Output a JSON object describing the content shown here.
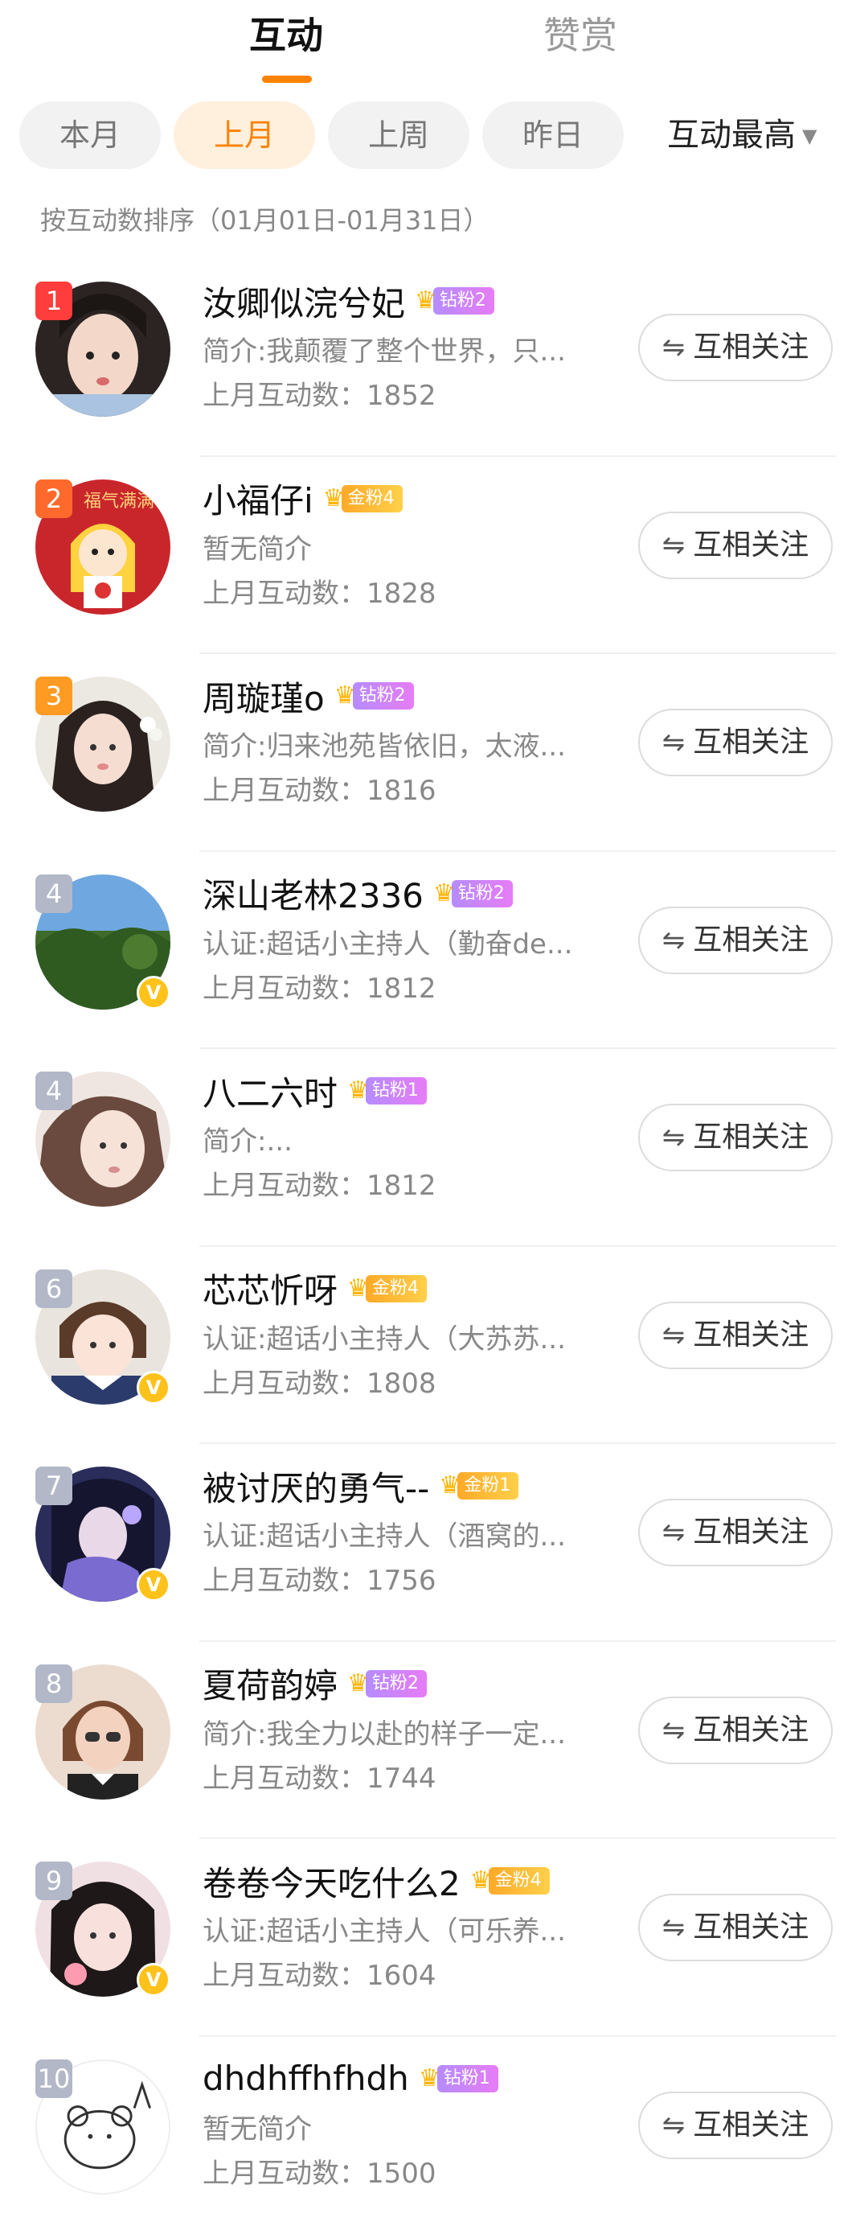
{
  "tabs": {
    "active": "互动",
    "other": "赞赏"
  },
  "filters": [
    "本月",
    "上月",
    "上周",
    "昨日"
  ],
  "active_filter_index": 1,
  "sort": {
    "label": "互动最高",
    "icon": "caret-down-icon"
  },
  "sort_hint": "按互动数排序（01月01日-01月31日）",
  "follow_label": "互相关注",
  "users": [
    {
      "rank": "1",
      "name": "汝卿似浣兮妃",
      "fan_level": "钻粉2",
      "fan_type": "diamond",
      "bio": "简介:我颠覆了整个世界，只...",
      "count": "上月互动数：1852",
      "verified": false
    },
    {
      "rank": "2",
      "name": "小福仔i",
      "fan_level": "金粉4",
      "fan_type": "gold",
      "bio": "暂无简介",
      "count": "上月互动数：1828",
      "verified": false
    },
    {
      "rank": "3",
      "name": "周璇瑾o",
      "fan_level": "钻粉2",
      "fan_type": "diamond",
      "bio": "简介:归来池苑皆依旧，太液...",
      "count": "上月互动数：1816",
      "verified": false
    },
    {
      "rank": "4",
      "name": "深山老林2336",
      "fan_level": "钻粉2",
      "fan_type": "diamond",
      "bio": "认证:超话小主持人（勤奋de...",
      "count": "上月互动数：1812",
      "verified": true
    },
    {
      "rank": "4",
      "name": "八二六时",
      "fan_level": "钻粉1",
      "fan_type": "diamond",
      "bio": "简介:...",
      "count": "上月互动数：1812",
      "verified": false
    },
    {
      "rank": "6",
      "name": "芯芯忻呀",
      "fan_level": "金粉4",
      "fan_type": "gold",
      "bio": "认证:超话小主持人（大苏苏...",
      "count": "上月互动数：1808",
      "verified": true
    },
    {
      "rank": "7",
      "name": "被讨厌的勇气--",
      "fan_level": "金粉1",
      "fan_type": "gold",
      "bio": "认证:超话小主持人（酒窝的...",
      "count": "上月互动数：1756",
      "verified": true
    },
    {
      "rank": "8",
      "name": "夏荷韵婷",
      "fan_level": "钻粉2",
      "fan_type": "diamond",
      "bio": "简介:我全力以赴的样子一定...",
      "count": "上月互动数：1744",
      "verified": false
    },
    {
      "rank": "9",
      "name": "卷卷今天吃什么2",
      "fan_level": "金粉4",
      "fan_type": "gold",
      "bio": "认证:超话小主持人（可乐养...",
      "count": "上月互动数：1604",
      "verified": true
    },
    {
      "rank": "10",
      "name": "dhdhffhfhdh",
      "fan_level": "钻粉1",
      "fan_type": "diamond",
      "bio": "暂无简介",
      "count": "上月互动数：1500",
      "verified": false
    }
  ],
  "colors": {
    "accent": "#ff8200",
    "rank1": "#ff3d3d",
    "rank2": "#ff6a2c",
    "rank3": "#ff9b22",
    "rank_other": "#b3b8c8",
    "verified": "#ffc21a"
  }
}
